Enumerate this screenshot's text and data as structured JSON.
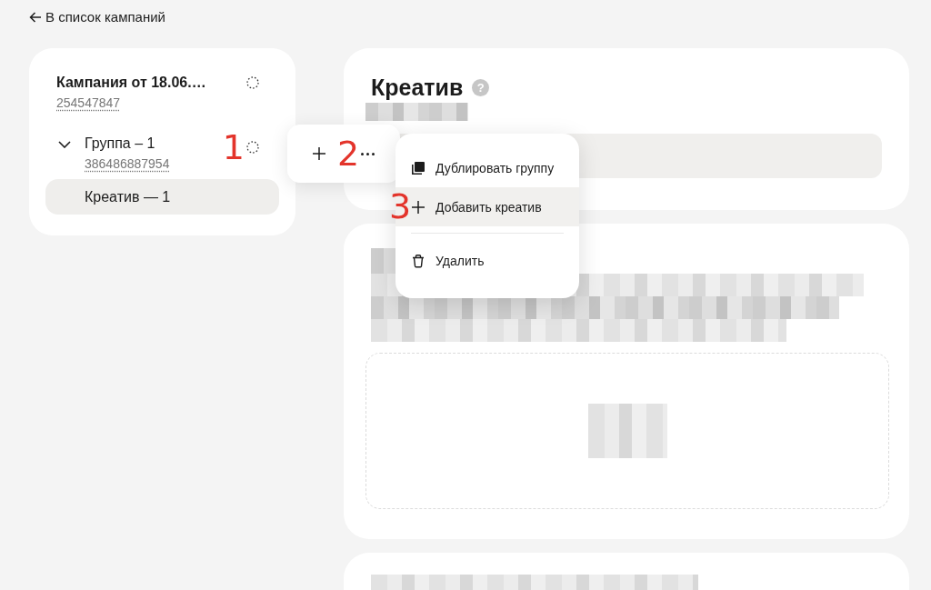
{
  "back_link": {
    "label": "В список кампаний"
  },
  "sidebar": {
    "campaign": {
      "title": "Кампания от 18.06.…",
      "id": "254547847"
    },
    "groups": [
      {
        "title": "Группа – 1",
        "id": "386486887954",
        "expanded": true,
        "annotation": "1",
        "children": [
          {
            "label": "Креатив — 1",
            "selected": true
          }
        ]
      }
    ]
  },
  "toolbar": {
    "annotation": "2"
  },
  "menu": {
    "open": true,
    "sections": [
      {
        "items": [
          {
            "kind": "duplicate",
            "label": "Дублировать группу",
            "selected": false
          },
          {
            "kind": "add",
            "label": "Добавить креатив",
            "selected": true,
            "annotation": "3"
          }
        ]
      },
      {
        "items": [
          {
            "kind": "delete",
            "label": "Удалить",
            "selected": false
          }
        ]
      }
    ]
  },
  "creative_card": {
    "title": "Креатив",
    "help": "?"
  }
}
